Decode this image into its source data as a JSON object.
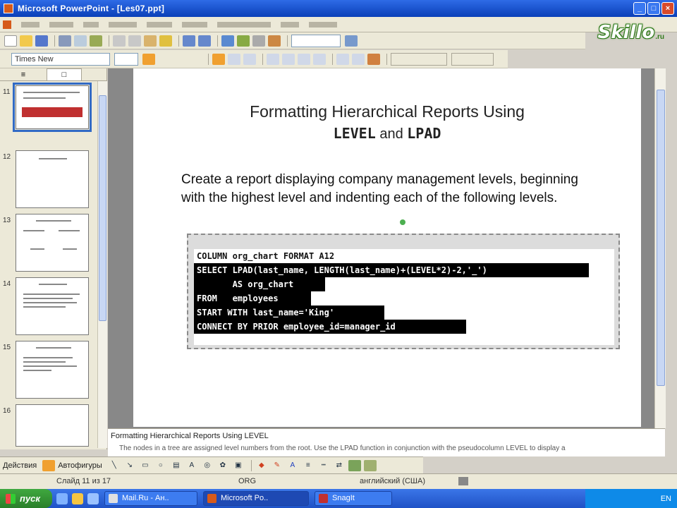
{
  "window": {
    "title": "Microsoft PowerPoint - [Les07.ppt]",
    "minimize": "_",
    "maximize": "□",
    "close": "×"
  },
  "logo": {
    "text": "Skillo",
    "suffix": ".ru"
  },
  "toolbar": {
    "font_name": "Times New"
  },
  "slides_pane": {
    "tab_slides": "□",
    "tab_outline": "≡",
    "thumbnails": [
      {
        "number": "11",
        "selected": true
      },
      {
        "number": "12",
        "selected": false
      },
      {
        "number": "13",
        "selected": false
      },
      {
        "number": "14",
        "selected": false
      },
      {
        "number": "15",
        "selected": false
      },
      {
        "number": "16",
        "selected": false
      }
    ]
  },
  "slide": {
    "title_line1": "Formatting Hierarchical Reports Using",
    "title_code1": "LEVEL",
    "title_and": " and ",
    "title_code2": "LPAD",
    "body": "Create a report displaying company management levels, beginning with the highest level and indenting each of the following levels.",
    "code_lines": [
      {
        "text": "COLUMN org_chart FORMAT A12",
        "highlight": false
      },
      {
        "text": "SELECT LPAD(last_name, LENGTH(last_name)+(LEVEL*2)-2,'_')",
        "highlight": true
      },
      {
        "text": "       AS org_chart",
        "highlight": true
      },
      {
        "text": "FROM   employees",
        "highlight": true
      },
      {
        "text": "START WITH last_name='King'",
        "highlight": true
      },
      {
        "text": "CONNECT BY PRIOR employee_id=manager_id",
        "highlight": true
      }
    ]
  },
  "notes": {
    "heading": "Formatting Hierarchical Reports Using LEVEL",
    "text": "The nodes in a tree are assigned level numbers from the root. Use the LPAD function in conjunction with the pseudocolumn LEVEL to display a"
  },
  "drawbar": {
    "draw_label": "Действия",
    "autoshapes_label": "Автофигуры"
  },
  "status": {
    "slide_info": "Слайд 11 из 17",
    "design": "ORG",
    "language": "английский (США)"
  },
  "taskbar": {
    "start_label": "пуск",
    "tasks": [
      {
        "label": "Mail.Ru - Ан..",
        "active": false
      },
      {
        "label": "Microsoft Po..",
        "active": true
      },
      {
        "label": "SnagIt",
        "active": false
      }
    ],
    "tray_text": "EN"
  }
}
